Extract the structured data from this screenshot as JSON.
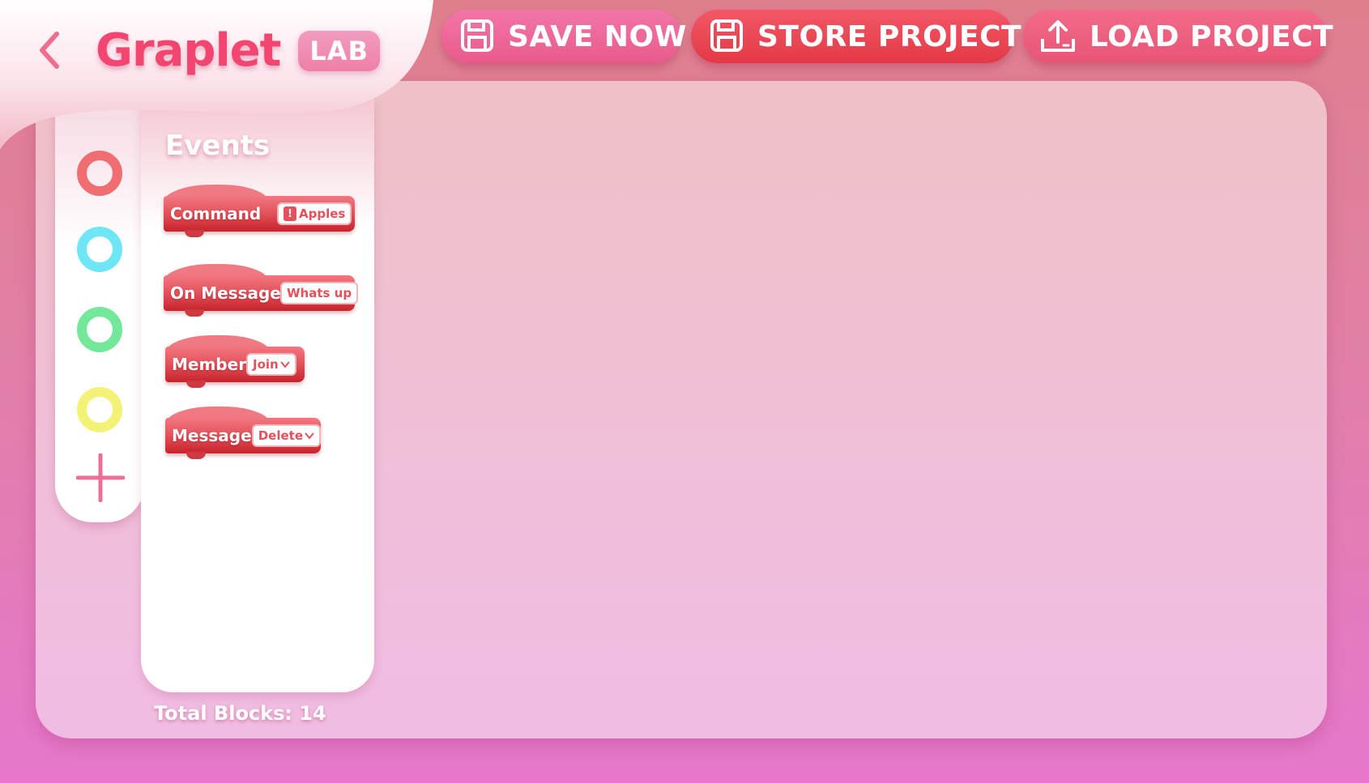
{
  "app": {
    "name": "Graplet",
    "badge": "LAB"
  },
  "toolbar": {
    "save_label": "SAVE NOW",
    "store_label": "STORE PROJECT",
    "load_label": "LOAD PROJECT"
  },
  "palette": {
    "colors": [
      {
        "name": "red",
        "hex": "#f06e72"
      },
      {
        "name": "cyan",
        "hex": "#6fe6f5"
      },
      {
        "name": "green",
        "hex": "#74e89a"
      },
      {
        "name": "yellow",
        "hex": "#f3f277"
      }
    ],
    "add_icon": "plus-icon"
  },
  "blocks_panel": {
    "category": "Events",
    "blocks": [
      {
        "label": "Command",
        "chip": "Apples",
        "chip_icon": "warning-icon"
      },
      {
        "label": "On Message",
        "chip": "Whats up"
      },
      {
        "label": "Member",
        "chip": "Join",
        "chip_icon": "chevron-down-icon"
      },
      {
        "label": "Message",
        "chip": "Delete",
        "chip_icon": "chevron-down-icon"
      }
    ]
  },
  "footer": {
    "total_blocks_label": "Total Blocks:  14"
  }
}
